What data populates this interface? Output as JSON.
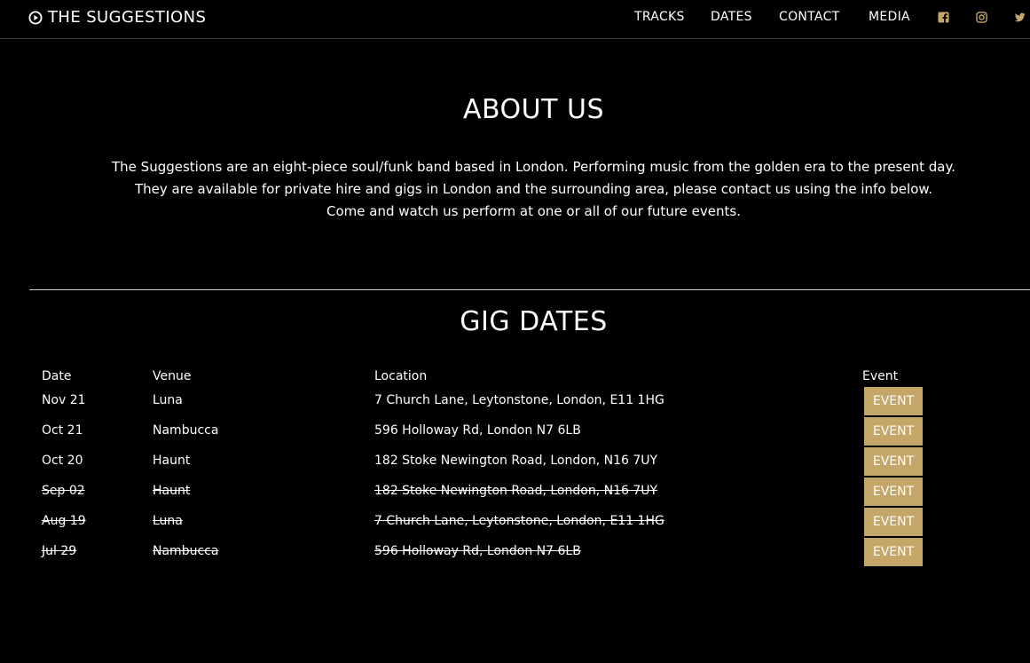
{
  "nav": {
    "brand": "THE SUGGESTIONS",
    "links": [
      "TRACKS",
      "DATES",
      "CONTACT",
      "MEDIA"
    ],
    "social_icons": [
      "facebook-icon",
      "instagram-icon",
      "twitter-icon"
    ],
    "accent_color": "#c4a669"
  },
  "about": {
    "title": "ABOUT US",
    "lines": [
      "The Suggestions are an eight-piece soul/funk band based in London. Performing music from the golden era to the present day.",
      "They are available for private hire and gigs in London and the surrounding area, please contact us using the info below.",
      "Come and watch us perform at one or all of our future events."
    ]
  },
  "gigs": {
    "title": "GIG DATES",
    "headers": {
      "date": "Date",
      "venue": "Venue",
      "location": "Location",
      "event": "Event"
    },
    "rows": [
      {
        "date": "Nov 21",
        "venue": "Luna",
        "location": "7 Church Lane, Leytonstone, London, E11 1HG",
        "button": "EVENT",
        "past": false
      },
      {
        "date": "Oct 21",
        "venue": "Nambucca",
        "location": "596 Holloway Rd, London N7 6LB",
        "button": "EVENT",
        "past": false
      },
      {
        "date": "Oct 20",
        "venue": "Haunt",
        "location": "182 Stoke Newington Road, London, N16 7UY",
        "button": "EVENT",
        "past": false
      },
      {
        "date": "Sep 02",
        "venue": "Haunt",
        "location": "182 Stoke Newington Road, London, N16 7UY",
        "button": "EVENT",
        "past": true
      },
      {
        "date": "Aug 19",
        "venue": "Luna",
        "location": "7 Church Lane, Leytonstone, London, E11 1HG",
        "button": "EVENT",
        "past": true
      },
      {
        "date": "Jul 29",
        "venue": "Nambucca",
        "location": "596 Holloway Rd, London N7 6LB",
        "button": "EVENT",
        "past": true
      }
    ]
  }
}
